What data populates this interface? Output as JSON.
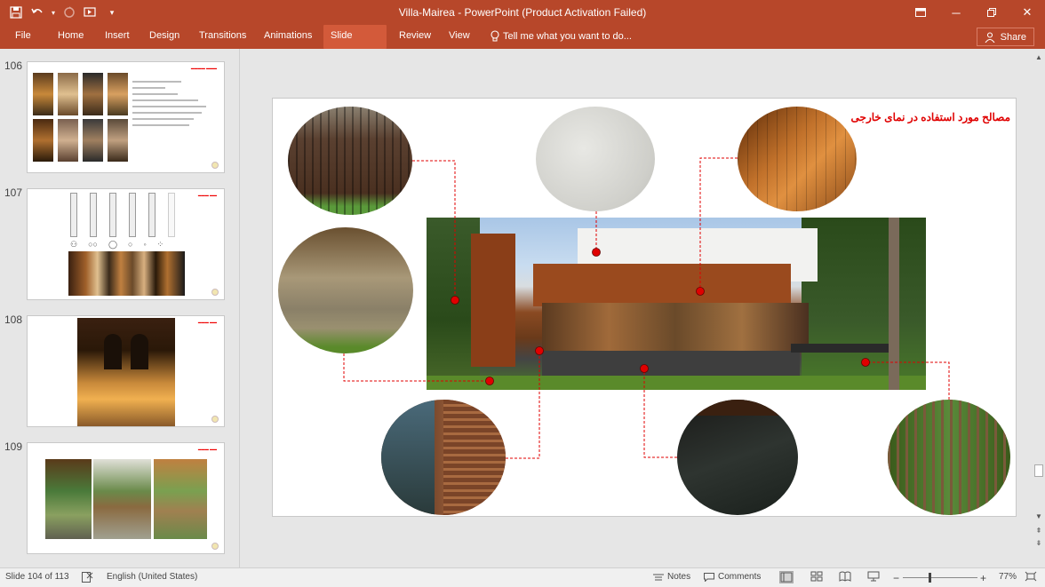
{
  "window": {
    "title": "Villa-Mairea  -  PowerPoint (Product Activation Failed)"
  },
  "ribbon": {
    "tabs": [
      "File",
      "Home",
      "Insert",
      "Design",
      "Transitions",
      "Animations",
      "Slide Show",
      "Review",
      "View"
    ],
    "active_tab": "Slide Show",
    "tell_me": "Tell me what you want to do...",
    "share": "Share"
  },
  "thumbnails": [
    {
      "number": "106"
    },
    {
      "number": "107"
    },
    {
      "number": "108"
    },
    {
      "number": "109"
    }
  ],
  "slide": {
    "title": "مصالح مورد استفاده در نمای خارجی"
  },
  "status": {
    "slide_info": "Slide 104 of 113",
    "language": "English (United States)",
    "notes": "Notes",
    "comments": "Comments",
    "zoom": "77%",
    "zoom_level": 0.77
  },
  "colors": {
    "accent": "#b7472a",
    "ribbon_active": "#d35a3a",
    "marker": "#e00000"
  }
}
